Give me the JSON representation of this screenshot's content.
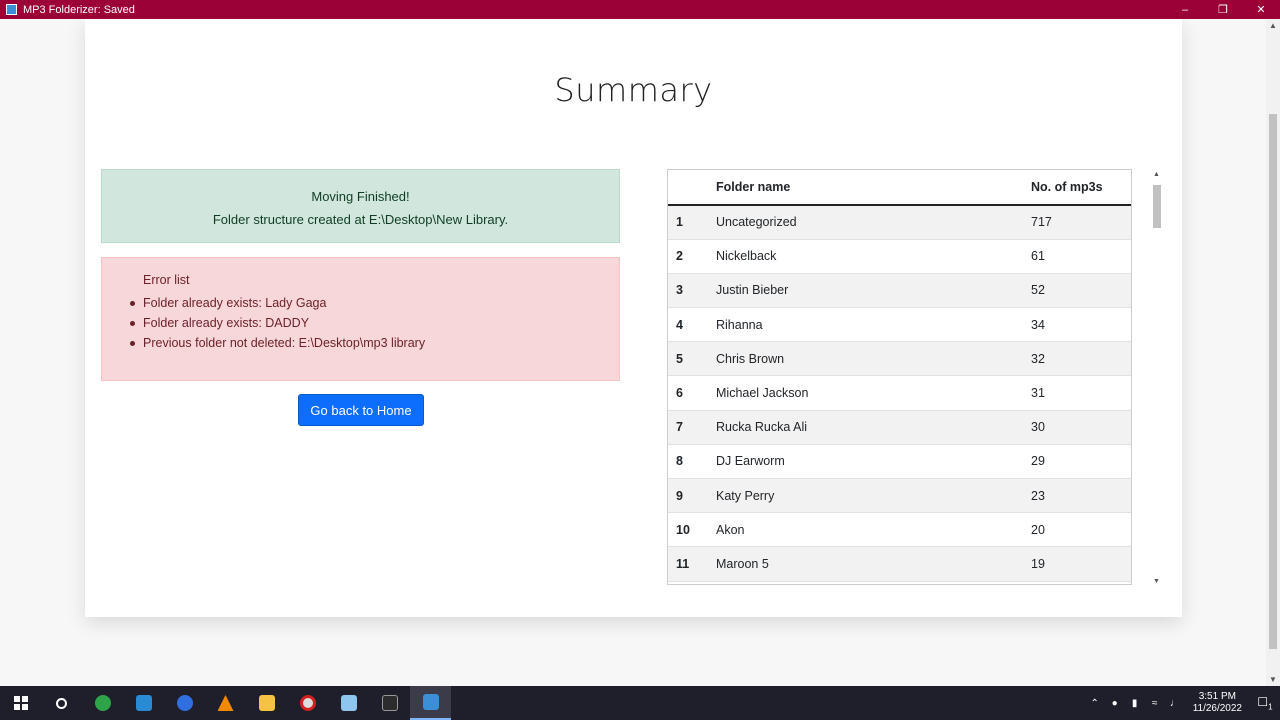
{
  "window": {
    "title": "MP3 Folderizer: Saved",
    "accent_color": "#9b0036"
  },
  "page": {
    "heading": "Summary",
    "success": {
      "line1": "Moving Finished!",
      "line2": "Folder structure created at E:\\Desktop\\New Library."
    },
    "errors": {
      "title": "Error list",
      "items": [
        "Folder already exists: Lady Gaga",
        "Folder already exists: DADDY",
        "Previous folder not deleted: E:\\Desktop\\mp3 library"
      ]
    },
    "home_button": "Go back to Home"
  },
  "table": {
    "headers": {
      "num": "",
      "name": "Folder name",
      "count": "No. of mp3s"
    },
    "rows": [
      {
        "num": "1",
        "name": "Uncategorized",
        "count": "717"
      },
      {
        "num": "2",
        "name": "Nickelback",
        "count": "61"
      },
      {
        "num": "3",
        "name": "Justin Bieber",
        "count": "52"
      },
      {
        "num": "4",
        "name": "Rihanna",
        "count": "34"
      },
      {
        "num": "5",
        "name": "Chris Brown",
        "count": "32"
      },
      {
        "num": "6",
        "name": "Michael Jackson",
        "count": "31"
      },
      {
        "num": "7",
        "name": "Rucka Rucka Ali",
        "count": "30"
      },
      {
        "num": "8",
        "name": "DJ Earworm",
        "count": "29"
      },
      {
        "num": "9",
        "name": "Katy Perry",
        "count": "23"
      },
      {
        "num": "10",
        "name": "Akon",
        "count": "20"
      },
      {
        "num": "11",
        "name": "Maroon 5",
        "count": "19"
      }
    ]
  },
  "taskbar": {
    "apps": [
      {
        "icon": "windows-start-icon",
        "color": "#ffffff"
      },
      {
        "icon": "search-icon",
        "color": "#ffffff"
      },
      {
        "icon": "edge-icon",
        "color": "#2fa34a"
      },
      {
        "icon": "vscode-icon",
        "color": "#2a8ad4"
      },
      {
        "icon": "firefox-icon",
        "color": "#2f6fe0"
      },
      {
        "icon": "vlc-icon",
        "color": "#f08a00"
      },
      {
        "icon": "file-explorer-icon",
        "color": "#f5c243"
      },
      {
        "icon": "obs-icon",
        "color": "#d02020"
      },
      {
        "icon": "notepad-icon",
        "color": "#8ec6f0"
      },
      {
        "icon": "terminal-icon",
        "color": "#2c2c2c"
      },
      {
        "icon": "mp3-folderizer-icon",
        "color": "#3a8fd6"
      }
    ],
    "time": "3:51 PM",
    "date": "11/26/2022",
    "notification_count": "1"
  }
}
